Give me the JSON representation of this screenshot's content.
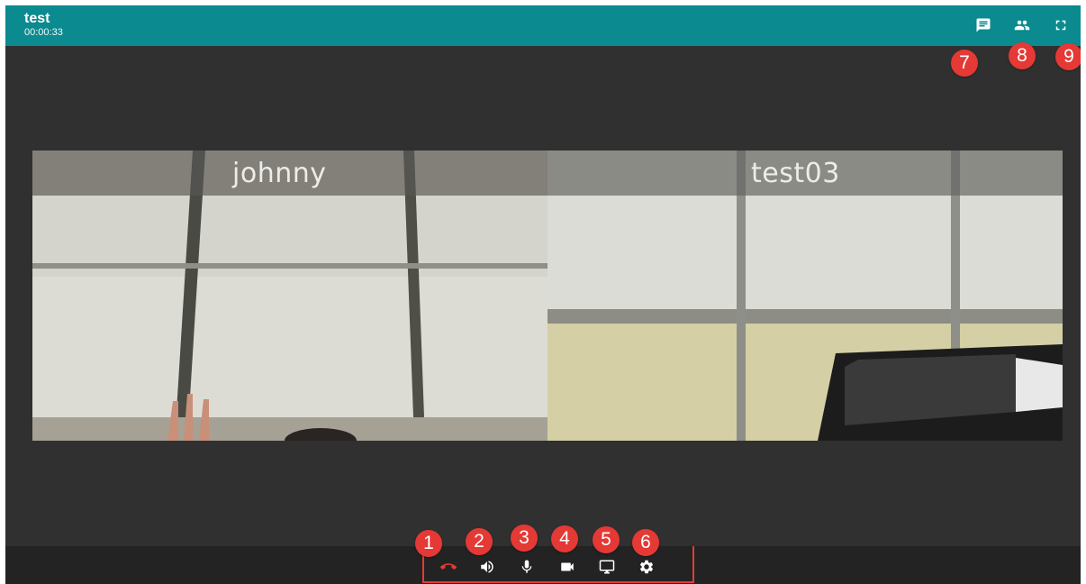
{
  "call": {
    "title": "test",
    "duration": "00:00:33"
  },
  "header": {
    "buttons": [
      {
        "name": "chat",
        "icon": "chat-icon"
      },
      {
        "name": "participants",
        "icon": "people-icon"
      },
      {
        "name": "fullscreen",
        "icon": "fullscreen-icon"
      }
    ]
  },
  "participants": [
    {
      "name": "johnny"
    },
    {
      "name": "test03"
    }
  ],
  "toolbar": {
    "buttons": [
      {
        "name": "hangup",
        "icon": "call-end-icon",
        "color": "#e53935"
      },
      {
        "name": "speaker",
        "icon": "volume-icon"
      },
      {
        "name": "microphone",
        "icon": "mic-icon"
      },
      {
        "name": "camera",
        "icon": "videocam-icon"
      },
      {
        "name": "screen-share",
        "icon": "monitor-icon"
      },
      {
        "name": "settings",
        "icon": "gear-icon"
      }
    ]
  },
  "annotations": [
    "1",
    "2",
    "3",
    "4",
    "5",
    "6",
    "7",
    "8",
    "9"
  ],
  "colors": {
    "header": "#0b8a8f",
    "background": "#2f2f2f",
    "toolbar": "#232323",
    "accent": "#e53935"
  }
}
